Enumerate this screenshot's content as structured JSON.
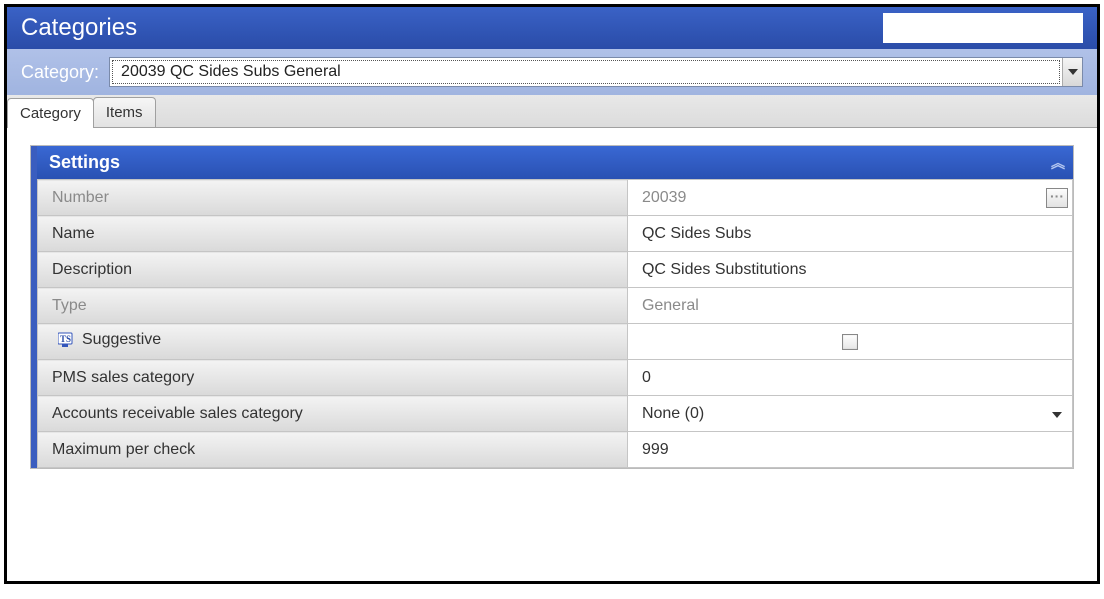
{
  "title": "Categories",
  "categorySelector": {
    "label": "Category:",
    "selected": "20039 QC Sides Subs General"
  },
  "tabs": {
    "category": "Category",
    "items": "Items"
  },
  "panel": {
    "title": "Settings"
  },
  "fields": {
    "number": {
      "label": "Number",
      "value": "20039"
    },
    "name": {
      "label": "Name",
      "value": "QC Sides Subs"
    },
    "description": {
      "label": "Description",
      "value": "QC Sides Substitutions"
    },
    "type": {
      "label": "Type",
      "value": "General"
    },
    "suggestive": {
      "label": "Suggestive",
      "checked": false
    },
    "pms": {
      "label": "PMS sales category",
      "value": "0"
    },
    "ar": {
      "label": "Accounts receivable sales category",
      "value": "None (0)"
    },
    "maxPerCheck": {
      "label": "Maximum per check",
      "value": "999"
    }
  }
}
